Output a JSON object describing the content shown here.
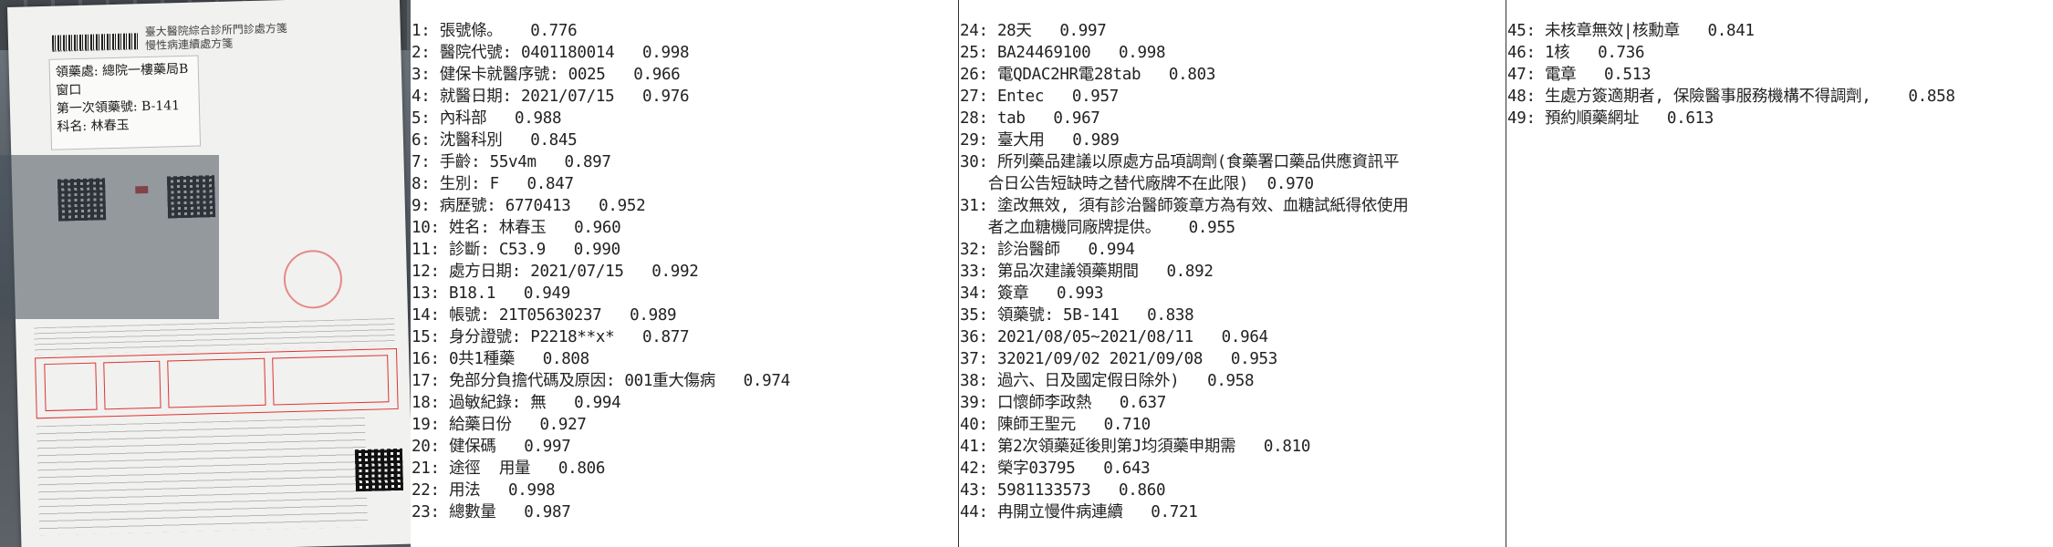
{
  "columns": [
    [
      "1: 張號條。   0.776",
      "2: 醫院代號: 0401180014   0.998",
      "3: 健保卡就醫序號: 0025   0.966",
      "4: 就醫日期: 2021/07/15   0.976",
      "5: 內科部   0.988",
      "6: 沈醫科別   0.845",
      "7: 手齡: 55v4m   0.897",
      "8: 生別: F   0.847",
      "9: 病歷號: 6770413   0.952",
      "10: 姓名: 林春玉   0.960",
      "11: 診斷: C53.9   0.990",
      "12: 處方日期: 2021/07/15   0.992",
      "13: B18.1   0.949",
      "14: 帳號: 21T05630237   0.989",
      "15: 身分證號: P2218**x*   0.877",
      "16: 0共1種藥   0.808",
      "17: 免部分負擔代碼及原因: 001重大傷病   0.974",
      "18: 過敏紀錄: 無   0.994",
      "19: 給藥日份   0.927",
      "20: 健保碼   0.997",
      "21: 途徑  用量   0.806",
      "22: 用法   0.998",
      "23: 總數量   0.987"
    ],
    [
      "24: 28天   0.997",
      "25: BA24469100   0.998",
      "26: 電QDAC2HR電28tab   0.803",
      "27: Entec   0.957",
      "28: tab   0.967",
      "29: 臺大用   0.989",
      "30: 所列藥品建議以原處方品項調劑(食藥署口藥品供應資訊平",
      "   合日公告短缺時之替代廠牌不在此限)  0.970",
      "31: 塗改無效, 須有診治醫師簽章方為有效、血糖試紙得依使用",
      "   者之血糖機同廠牌提供。   0.955",
      "32: 診治醫師   0.994",
      "33: 第品次建議領藥期間   0.892",
      "34: 簽章   0.993",
      "35: 領藥號: 5B-141   0.838",
      "36: 2021/08/05~2021/08/11   0.964",
      "37: 32021/09/02 2021/09/08   0.953",
      "38: 過六、日及國定假日除外)   0.958",
      "39: 口懷師李政熱   0.637",
      "40: 陳師王聖元   0.710",
      "41: 第2次領藥延後則第J均須藥申期需   0.810",
      "42: 榮字03795   0.643",
      "43: 5981133573   0.860",
      "44: 冉開立慢件病連續   0.721"
    ],
    [
      "45: 未核章無效|核勳章   0.841",
      "46: 1核   0.736",
      "47: 電章   0.513",
      "48: 生處方簽適期者, 保險醫事服務機構不得調劑,    0.858",
      "49: 預約順藥網址   0.613"
    ]
  ],
  "photo": {
    "title_line1": "臺大醫院綜合診所門診處方箋",
    "title_line2": "慢性病連續處方箋",
    "handwritten_line1": "領藥處: 總院一樓藥局B窗口",
    "handwritten_line2": "第一次領藥號: B-141",
    "handwritten_line3": "科名: 林春玉"
  }
}
